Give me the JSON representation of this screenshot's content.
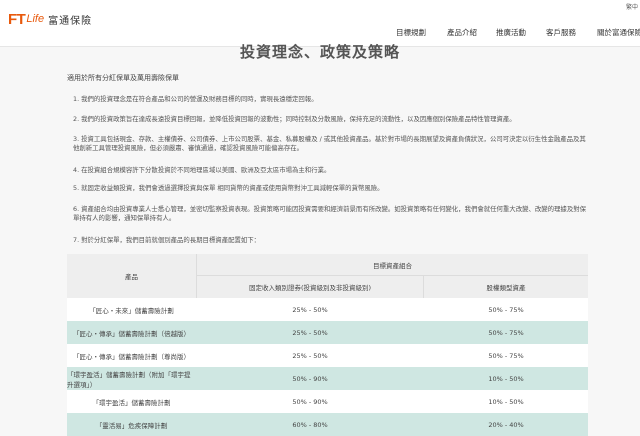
{
  "header": {
    "logo_ft": "FT",
    "logo_life": "Life",
    "logo_cn": "富通保險",
    "lang_label": "繁中",
    "nav": [
      "目標規劃",
      "產品介紹",
      "推廣活動",
      "客戶服務",
      "關於富通保險"
    ]
  },
  "page": {
    "title": "投資理念、政策及策略",
    "subtitle": "適用於所有分紅保單及萬用壽險保單",
    "items": [
      "1. 我們的投資理念是在符合產品和公司的營運及財務目標的同時，實現長遠穩定回報。",
      "2. 我們的投資政策旨在達成長遠投資目標回報，並降低投資回報的波動性；同時控制及分散風險，保持充足的流動性，以及因應個別保險產品特性管理資產。",
      "3. 投資工具包括現金、存款、主權債券、公司債券、上市公司股票、基金、私募股權及 / 或其他投資產品。基於對市場的長期展望及資產負債狀況，公司可決定以衍生性金融產品及其他創新工具管理投資風險，但必須嚴肅、審慎通過，確認投資風險可能偏高存在。",
      "4. 在投資組合規模容許下分散投資於不同地理區域以美國、歐洲及亞太區市場為主和行業。",
      "5. 就固定收益類投資，我們會透過選擇投資與保單 相同貨幣的資產或使用貨幣對沖工具減輕保單的貨幣風險。",
      "6. 資產組合均由投資專業人士悉心管理，並密切監察投資表現。投資策略可能因投資需要和經濟前景而有所改變。如投資策略有任何變化，我們會就任何重大改變、改變的理據及對保單持有人的影響，通知保單持有人。",
      "7. 對於分紅保單，我們目前就個別產品的長期目標資產配置如下："
    ]
  },
  "table": {
    "col_product": "產品",
    "col_group": "目標資產組合",
    "col_fixed_income": "固定收入類別證券(投資級別及非投資級別)",
    "col_growth": "股權類型資產",
    "rows": [
      {
        "product": "「匠心・未來」儲蓄壽險計劃",
        "fixed": "25% - 50%",
        "growth": "50% - 75%"
      },
      {
        "product": "「匠心・傳承」儲蓄壽險計劃（倍越版）",
        "fixed": "25% - 50%",
        "growth": "50% - 75%"
      },
      {
        "product": "「匠心・傳承」儲蓄壽險計劃（尊尚版）",
        "fixed": "25% - 50%",
        "growth": "50% - 75%"
      },
      {
        "product": "「環宇盈活」儲蓄壽險計劃（附加「環宇提升選項」）",
        "fixed": "50% - 90%",
        "growth": "10% - 50%"
      },
      {
        "product": "「環宇盈活」儲蓄壽險計劃",
        "fixed": "50% - 90%",
        "growth": "10% - 50%"
      },
      {
        "product": "「靈活易」危疾保障計劃",
        "fixed": "60% - 80%",
        "growth": "20% - 40%"
      }
    ]
  }
}
